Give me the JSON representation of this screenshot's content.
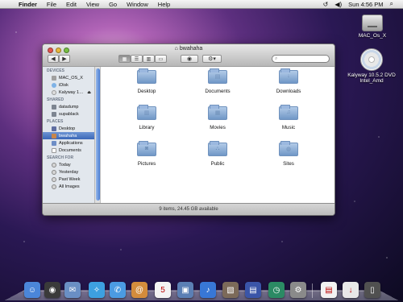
{
  "menubar": {
    "items": [
      "Finder",
      "File",
      "Edit",
      "View",
      "Go",
      "Window",
      "Help"
    ],
    "clock": "Sun 4:56 PM"
  },
  "desktop_icons": [
    {
      "label": "MAC_Os_X",
      "icon": "hard-drive-icon"
    },
    {
      "label": "Kalyway 10.5.2 DVD Intel_Amd",
      "icon": "dvd-icon"
    }
  ],
  "window": {
    "title": "bwahaha",
    "status": "9 items, 24.45 GB available",
    "search_placeholder": ""
  },
  "sidebar": {
    "devices_header": "DEVICES",
    "devices": [
      {
        "label": "MAC_OS_X",
        "icon": "hard-drive-icon"
      },
      {
        "label": "iDisk",
        "icon": "idisk-icon"
      },
      {
        "label": "Kalyway 1…",
        "icon": "dvd-icon"
      }
    ],
    "shared_header": "SHARED",
    "shared": [
      {
        "label": "datadump",
        "icon": "network-drive-icon"
      },
      {
        "label": "supablack",
        "icon": "network-drive-icon"
      }
    ],
    "places_header": "PLACES",
    "places": [
      {
        "label": "Desktop",
        "icon": "desktop-icon"
      },
      {
        "label": "bwahaha",
        "icon": "home-icon"
      },
      {
        "label": "Applications",
        "icon": "applications-icon"
      },
      {
        "label": "Documents",
        "icon": "documents-icon"
      }
    ],
    "search_header": "SEARCH FOR",
    "search": [
      {
        "label": "Today",
        "icon": "clock-icon"
      },
      {
        "label": "Yesterday",
        "icon": "clock-icon"
      },
      {
        "label": "Past Week",
        "icon": "clock-icon"
      },
      {
        "label": "All Images",
        "icon": "images-icon"
      }
    ]
  },
  "files": [
    {
      "label": "Desktop",
      "glyph": ""
    },
    {
      "label": "Documents",
      "glyph": "▤"
    },
    {
      "label": "Downloads",
      "glyph": "↓"
    },
    {
      "label": "Library",
      "glyph": "▥"
    },
    {
      "label": "Movies",
      "glyph": "▦"
    },
    {
      "label": "Music",
      "glyph": "♫"
    },
    {
      "label": "Pictures",
      "glyph": "◙"
    },
    {
      "label": "Public",
      "glyph": "⛬"
    },
    {
      "label": "Sites",
      "glyph": "◍"
    }
  ],
  "dock": [
    {
      "name": "finder-icon",
      "color": "#4b86d9",
      "glyph": "☺"
    },
    {
      "name": "dashboard-icon",
      "color": "#3a3a3a",
      "glyph": "◉"
    },
    {
      "name": "mail-icon",
      "color": "#6a8fc4",
      "glyph": "✉"
    },
    {
      "name": "safari-icon",
      "color": "#3da0e0",
      "glyph": "✧"
    },
    {
      "name": "ichat-icon",
      "color": "#4b9be2",
      "glyph": "✆"
    },
    {
      "name": "address-book-icon",
      "color": "#d38c3c",
      "glyph": "@"
    },
    {
      "name": "ical-icon",
      "color": "#f4f4f4",
      "glyph": "5"
    },
    {
      "name": "preview-icon",
      "color": "#5b7fb4",
      "glyph": "▣"
    },
    {
      "name": "itunes-icon",
      "color": "#3877d6",
      "glyph": "♪"
    },
    {
      "name": "iphoto-icon",
      "color": "#7c6a59",
      "glyph": "▧"
    },
    {
      "name": "spaces-icon",
      "color": "#3a55a8",
      "glyph": "▤"
    },
    {
      "name": "time-machine-icon",
      "color": "#2b8a64",
      "glyph": "◷"
    },
    {
      "name": "system-preferences-icon",
      "color": "#8a8a8a",
      "glyph": "⚙"
    },
    {
      "name": "documents-stack-icon",
      "color": "#f2f2f2",
      "glyph": "▤"
    },
    {
      "name": "downloads-stack-icon",
      "color": "#e8e8e8",
      "glyph": "↓"
    },
    {
      "name": "trash-icon",
      "color": "#505050",
      "glyph": "▯"
    }
  ]
}
